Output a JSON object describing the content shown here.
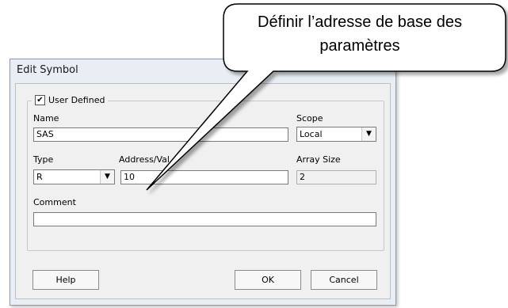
{
  "dialog": {
    "title": "Edit Symbol",
    "user_defined_label": "User Defined",
    "user_defined_checked": true,
    "name_label": "Name",
    "name_value": "SAS",
    "scope_label": "Scope",
    "scope_value": "Local",
    "type_label": "Type",
    "type_value": "R",
    "address_label": "Address/Val",
    "address_value": "10",
    "array_size_label": "Array Size",
    "array_size_value": "2",
    "comment_label": "Comment",
    "comment_value": "",
    "help_label": "Help",
    "ok_label": "OK",
    "cancel_label": "Cancel"
  },
  "callout": {
    "line1": "Définir l’adresse de base des",
    "line2": "paramètres"
  }
}
